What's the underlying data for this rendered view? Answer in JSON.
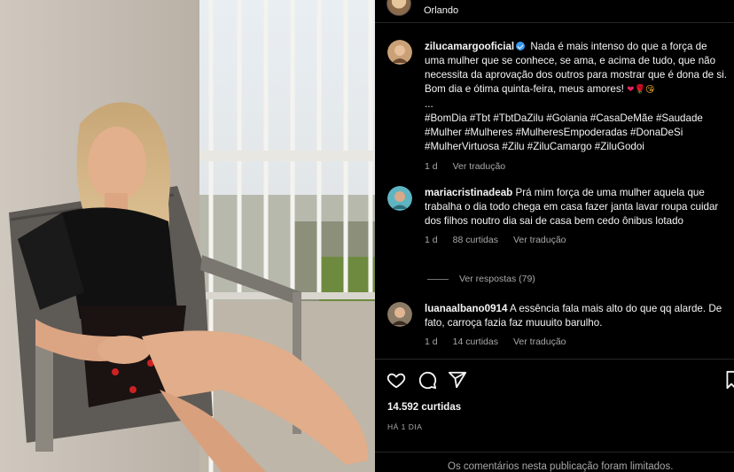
{
  "post": {
    "location": "Orlando",
    "more_label": "•••"
  },
  "caption": {
    "username": "zilucamargooficial",
    "text": "Nada é mais intenso do que a força de uma mulher que se conhece, se ama, e acima de tudo, que não necessita da aprovação dos outros para mostrar que é dona de si. Bom dia e ótima quinta-feira, meus amores!",
    "emojis": [
      "❤",
      "🌹",
      "😘"
    ],
    "ellipsis": "...",
    "hashtags": "#BomDia #Tbt #TbtDaZilu #Goiania #CasaDeMãe #Saudade #Mulher #Mulheres #MulheresEmpoderadas #DonaDeSi #MulherVirtuosa #Zilu #ZiluCamargo #ZiluGodoi",
    "time": "1 d",
    "translate": "Ver tradução"
  },
  "comments": [
    {
      "username": "mariacristinadeab",
      "text": "Prá mim força de uma mulher aquela que trabalha o dia todo chega em casa fazer janta lavar roupa cuidar dos filhos noutro dia sai de casa bem cedo ônibus lotado",
      "time": "1 d",
      "likes": "88 curtidas",
      "translate": "Ver tradução",
      "replies": "Ver respostas (79)"
    },
    {
      "username": "luanaalbano0914",
      "text": "A essência fala mais alto do que qq alarde. De fato, carroça fazia faz muuuito barulho.",
      "time": "1 d",
      "likes": "14 curtidas",
      "translate": "Ver tradução"
    }
  ],
  "actions": {
    "icons": [
      "heart-icon",
      "comment-icon",
      "share-icon",
      "bookmark-icon"
    ],
    "likes": "14.592 curtidas",
    "date": "HÁ 1 DIA"
  },
  "footer": {
    "text": "Os comentários nesta publicação foram limitados."
  }
}
